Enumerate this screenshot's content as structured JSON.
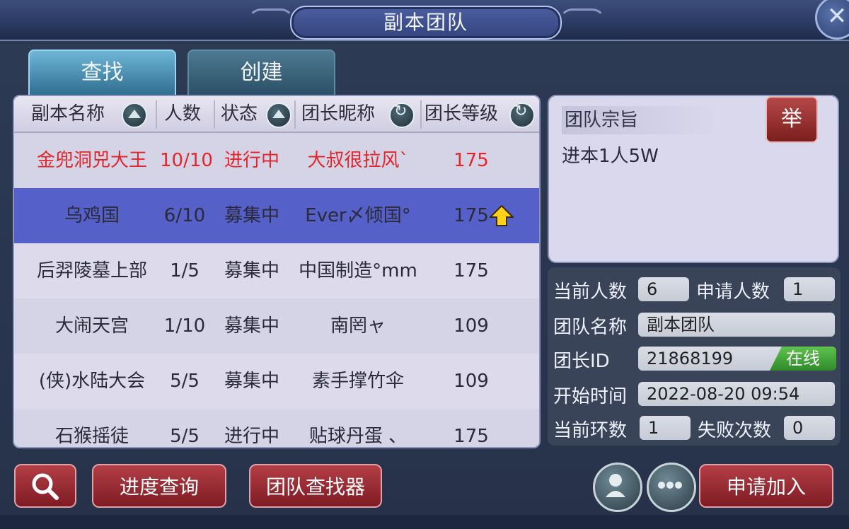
{
  "window": {
    "title": "副本团队",
    "close_icon": "✕"
  },
  "tabs": [
    {
      "label": "查找",
      "active": true
    },
    {
      "label": "创建",
      "active": false
    }
  ],
  "list": {
    "headers": [
      "副本名称",
      "人数",
      "状态",
      "团长昵称",
      "团长等级"
    ],
    "rows": [
      {
        "name": "金兜洞兕大王",
        "count": "10/10",
        "status": "进行中",
        "leader": "大叔很拉风`",
        "level": "175",
        "style": "red"
      },
      {
        "name": "乌鸡国",
        "count": "6/10",
        "status": "募集中",
        "leader": "Ever〆倾国°",
        "level": "175",
        "style": "selected",
        "level_up": true
      },
      {
        "name": "后羿陵墓上部",
        "count": "1/5",
        "status": "募集中",
        "leader": "中国制造°mm",
        "level": "175",
        "style": "normal"
      },
      {
        "name": "大闹天宫",
        "count": "1/10",
        "status": "募集中",
        "leader": "南罔ャ",
        "level": "109",
        "style": "alt"
      },
      {
        "name": "(侠)水陆大会",
        "count": "5/5",
        "status": "募集中",
        "leader": "素手撑竹伞",
        "level": "109",
        "style": "normal"
      },
      {
        "name": "石猴摇徒",
        "count": "5/5",
        "status": "进行中",
        "leader": "贴球丹蛋 、",
        "level": "175",
        "style": "alt"
      }
    ]
  },
  "info": {
    "label": "团队宗旨",
    "report_label": "举",
    "text": "进本1人5W"
  },
  "stats": {
    "current_members_label": "当前人数",
    "current_members": "6",
    "applicants_label": "申请人数",
    "applicants": "1",
    "team_name_label": "团队名称",
    "team_name": "副本团队",
    "leader_id_label": "团长ID",
    "leader_id": "21868199",
    "online_label": "在线",
    "start_time_label": "开始时间",
    "start_time": "2022-08-20 09:54",
    "round_label": "当前环数",
    "round": "1",
    "fail_label": "失败次数",
    "fail": "0"
  },
  "bottom": {
    "search_icon": "search-icon",
    "progress_label": "进度查询",
    "finder_label": "团队查找器",
    "apply_label": "申请加入"
  }
}
